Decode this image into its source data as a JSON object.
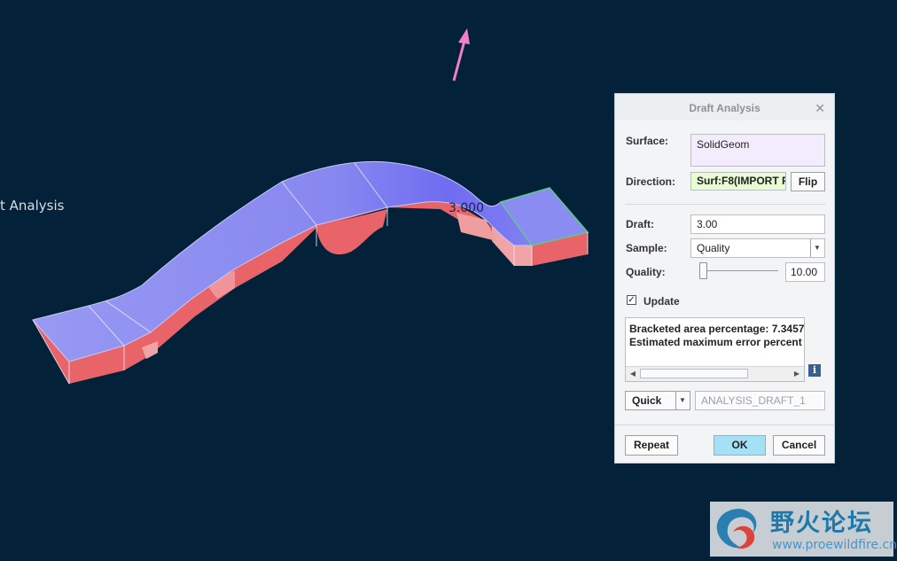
{
  "viewport": {
    "partial_label": "t Analysis",
    "draft_value_label": "3.000"
  },
  "dialog": {
    "title": "Draft Analysis",
    "surface_label": "Surface:",
    "surface_value": "SolidGeom",
    "direction_label": "Direction:",
    "direction_value": "Surf:F8(IMPORT F",
    "flip_label": "Flip",
    "draft_label": "Draft:",
    "draft_value": "3.00",
    "sample_label": "Sample:",
    "sample_value": "Quality",
    "quality_label": "Quality:",
    "quality_value": "10.00",
    "quality_slider_fraction": 0.05,
    "update_label": "Update",
    "update_checked": true,
    "output_line_1": "Bracketed area percentage: 7.3457",
    "output_line_2": "Estimated maximum error percent",
    "info_label": "i",
    "mode_value": "Quick",
    "name_value": "ANALYSIS_DRAFT_1",
    "repeat_label": "Repeat",
    "ok_label": "OK",
    "cancel_label": "Cancel"
  },
  "watermark": {
    "title_cn": "野火论坛",
    "url": "www.proewildfire.cn"
  },
  "colors": {
    "background": "#03223a",
    "draft_positive": "#8d8cf2",
    "draft_negative": "#e05f63",
    "arrow": "#f07fc8",
    "ok_button": "#a6e0f7"
  }
}
